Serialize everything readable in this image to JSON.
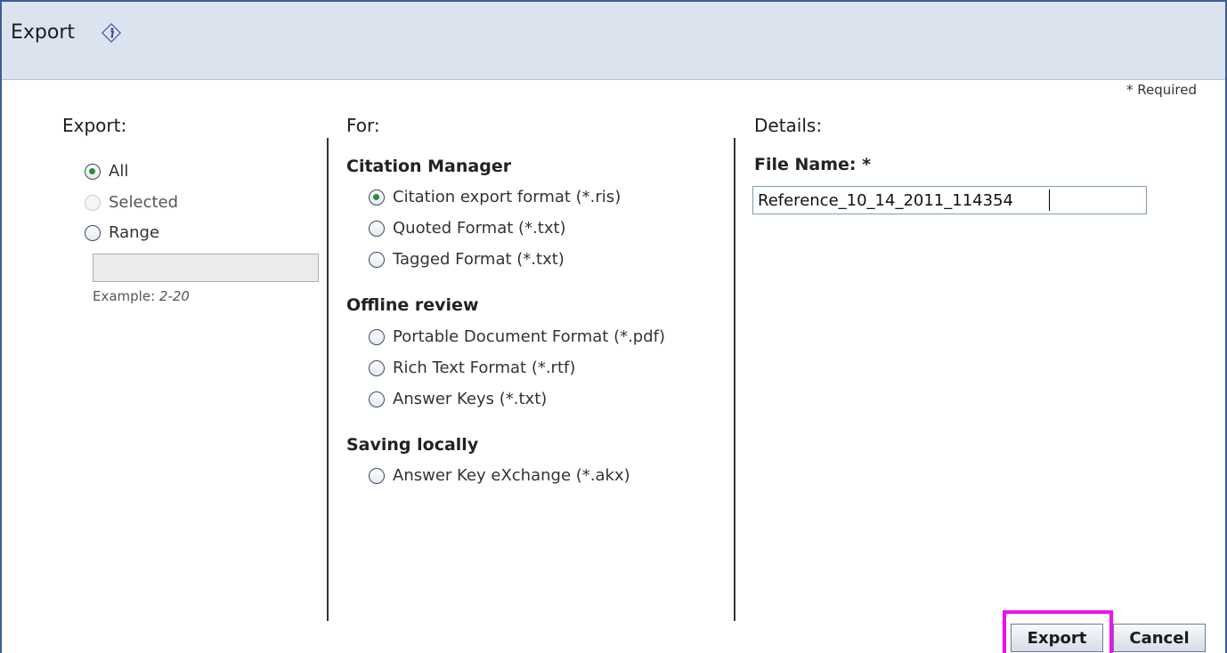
{
  "header": {
    "title": "Export"
  },
  "required_note": "* Required",
  "export_col": {
    "heading": "Export:",
    "options": [
      {
        "label": "All",
        "checked": true,
        "disabled": false
      },
      {
        "label": "Selected",
        "checked": false,
        "disabled": true
      },
      {
        "label": "Range",
        "checked": false,
        "disabled": false
      }
    ],
    "range_value": "",
    "example_label": "Example:",
    "example_value": "2-20"
  },
  "for_col": {
    "heading": "For:",
    "groups": [
      {
        "title": "Citation Manager",
        "options": [
          {
            "label": "Citation export format (*.ris)",
            "checked": true
          },
          {
            "label": "Quoted Format (*.txt)",
            "checked": false
          },
          {
            "label": "Tagged Format (*.txt)",
            "checked": false
          }
        ]
      },
      {
        "title": "Offline review",
        "options": [
          {
            "label": "Portable Document Format (*.pdf)",
            "checked": false
          },
          {
            "label": "Rich Text Format (*.rtf)",
            "checked": false
          },
          {
            "label": "Answer Keys (*.txt)",
            "checked": false
          }
        ]
      },
      {
        "title": "Saving locally",
        "options": [
          {
            "label": "Answer Key eXchange (*.akx)",
            "checked": false
          }
        ]
      }
    ]
  },
  "details_col": {
    "heading": "Details:",
    "file_name_label": "File Name: *",
    "file_name_value": "Reference_10_14_2011_114354"
  },
  "buttons": {
    "export_label": "Export",
    "cancel_label": "Cancel"
  },
  "colors": {
    "header_bg": "#dbe3ef",
    "border": "#3a5f94",
    "highlight": "#ee11ee",
    "radio_dot": "#2f8b3a"
  },
  "icons": {
    "title_icon": "info-icon"
  }
}
